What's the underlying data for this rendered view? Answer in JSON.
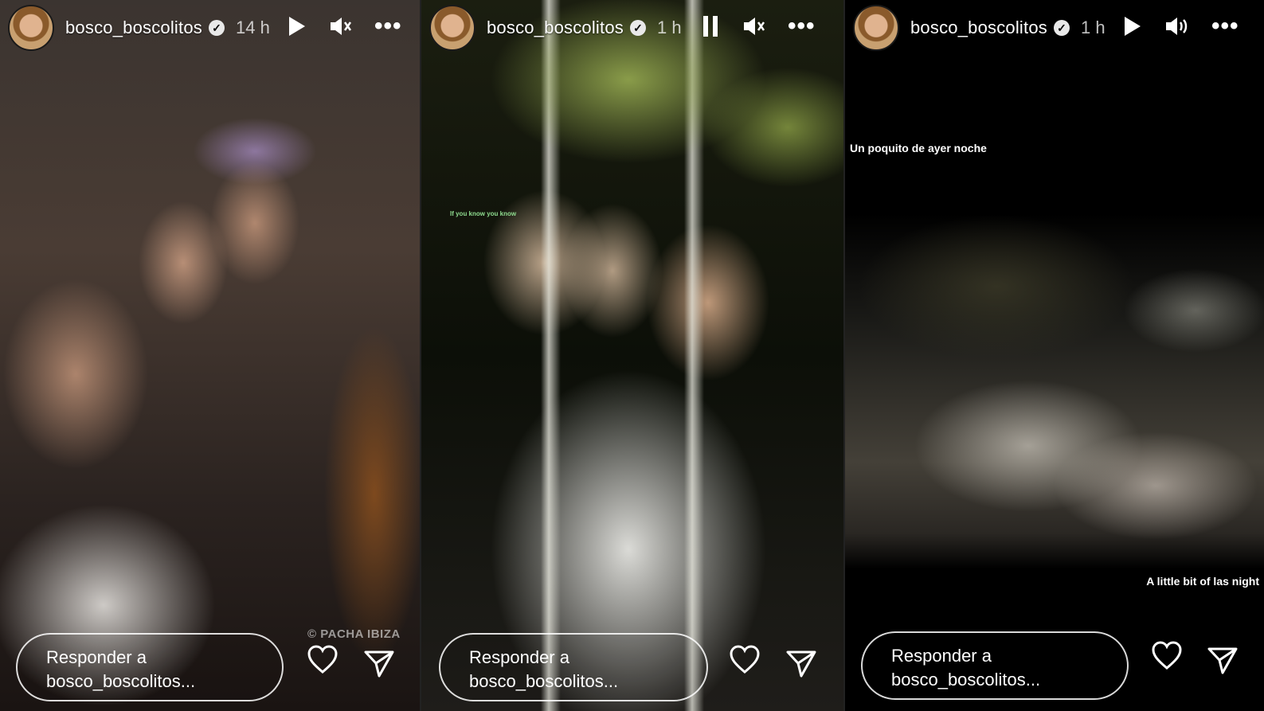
{
  "stories": [
    {
      "username": "bosco_boscolitos",
      "time": "14 h",
      "playback": "play",
      "sound": "muted",
      "sticker": "© PACHA IBIZA",
      "reply_placeholder": "Responder a bosco_boscolitos...",
      "reply_line1": "Responder a",
      "reply_line2": "bosco_boscolitos..."
    },
    {
      "username": "bosco_boscolitos",
      "time": "1 h",
      "playback": "pause",
      "sound": "muted",
      "caption": "If you know you know",
      "reply_line1": "Responder a",
      "reply_line2": "bosco_boscolitos..."
    },
    {
      "username": "bosco_boscolitos",
      "time": "1 h",
      "playback": "play",
      "sound": "on",
      "caption_top": "Un poquito de ayer noche",
      "caption_bottom": "A little bit of las night",
      "reply_line1": "Responder a",
      "reply_line2": "bosco_boscolitos..."
    }
  ],
  "icons": {
    "verified": "✓",
    "more": "•••"
  }
}
